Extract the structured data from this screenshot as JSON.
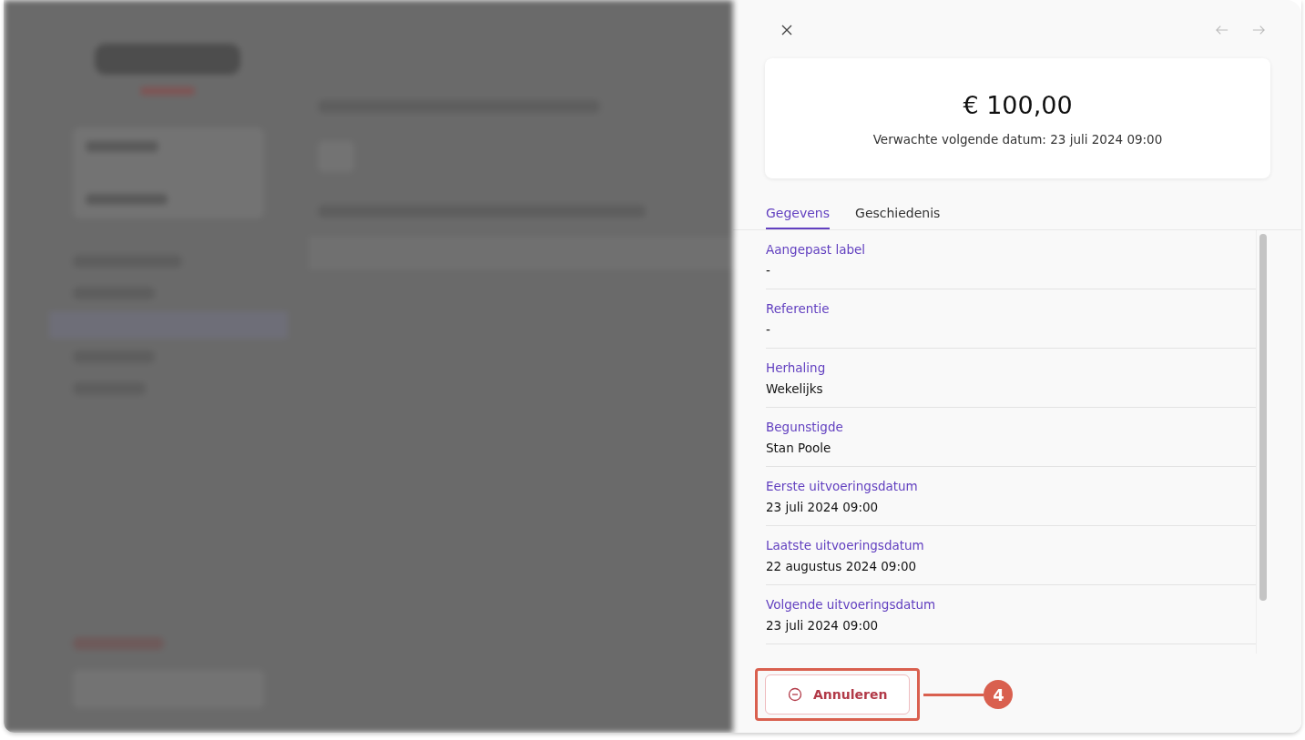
{
  "panel": {
    "amount": "€ 100,00",
    "subtitle": "Verwachte volgende datum: 23 juli 2024 09:00",
    "tabs": [
      {
        "label": "Gegevens",
        "selected": true
      },
      {
        "label": "Geschiedenis",
        "selected": false
      }
    ],
    "fields": [
      {
        "label": "Aangepast label",
        "value": "-"
      },
      {
        "label": "Referentie",
        "value": "-"
      },
      {
        "label": "Herhaling",
        "value": "Wekelijks"
      },
      {
        "label": "Begunstigde",
        "value": "Stan Poole"
      },
      {
        "label": "Eerste uitvoeringsdatum",
        "value": "23 juli 2024 09:00"
      },
      {
        "label": "Laatste uitvoeringsdatum",
        "value": "22 augustus 2024 09:00"
      },
      {
        "label": "Volgende uitvoeringsdatum",
        "value": "23 juli 2024 09:00"
      }
    ],
    "cancel_button": "Annuleren"
  },
  "callout": {
    "number": "4"
  }
}
